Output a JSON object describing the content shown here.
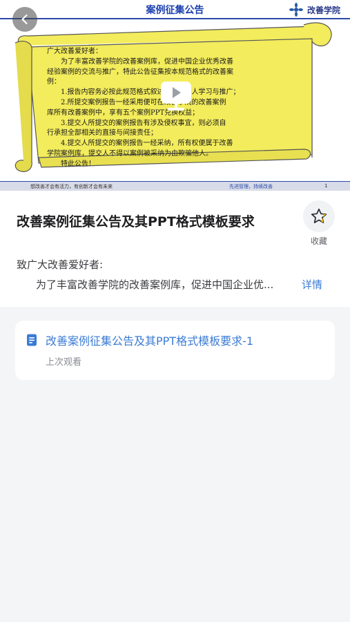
{
  "video": {
    "slide_title": "案例征集公告",
    "slide_logo_text": "改善学院",
    "slide_lines": [
      "广大改善爱好者：",
      "　　为了丰富改善学院的改善案例库，促进中国企业优秀改善",
      "经验案例的交流与推广，特此公告征集按本规范格式的改善案",
      "例：",
      "　　1.报告内容务必按此规范格式叙述，便于他人学习与推广；",
      "　　2.所提交案例报告一经采用便可在改善学院的改善案例",
      "库所有改善案例中，享有五个案例PPT兑换权益；",
      "　　3.提交人所提交的案例报告有涉及侵权事宜，则必须自",
      "行承担全部相关的直接与间接责任；",
      "　　4.提交人所提交的案例报告一经采纳，所有权便属于改善",
      "学院案例库，提交人不得以案例被采纳为由欺骗他人。",
      "　　特此公告！"
    ],
    "footer_left": "想改善才会有活力，有创新才会有未来",
    "footer_right": "先进管理，持续改善",
    "footer_page": "1"
  },
  "icons": {
    "back": "back-icon",
    "play": "play-icon",
    "star": "star-icon",
    "document": "document-icon"
  },
  "info": {
    "title": "改善案例征集公告及其PPT格式模板要求",
    "favorite_label": "收藏",
    "greeting": "致广大改善爱好者:",
    "summary": "为了丰富改善学院的改善案例库，促进中国企业优...",
    "detail_label": "详情"
  },
  "chapter": {
    "title": "改善案例征集公告及其PPT格式模板要求-1",
    "subtitle": "上次观看"
  },
  "colors": {
    "accent": "#3a7bd5",
    "star": "#f5c518",
    "scroll": "#f3ec5c"
  }
}
